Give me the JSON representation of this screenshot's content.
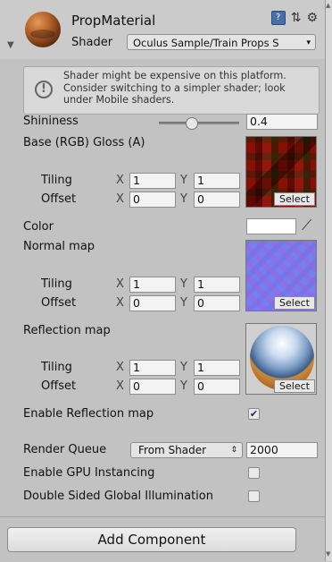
{
  "header": {
    "title": "PropMaterial",
    "shader_label": "Shader",
    "shader_value": "Oculus Sample/Train Props S",
    "icons": [
      "material-sphere-icon",
      "book-icon",
      "preset-icon",
      "gear-icon"
    ]
  },
  "warning": {
    "text": "Shader might be expensive on this platform. Consider switching to a simpler shader; look under Mobile shaders."
  },
  "shininess": {
    "label": "Shininess",
    "value": "0.4",
    "level": 0.4
  },
  "base": {
    "label": "Base (RGB) Gloss (A)",
    "tiling_label": "Tiling",
    "offset_label": "Offset",
    "tiling_x": "1",
    "tiling_y": "1",
    "offset_x": "0",
    "offset_y": "0",
    "select": "Select"
  },
  "color": {
    "label": "Color",
    "value": "#ffffff"
  },
  "normal": {
    "label": "Normal map",
    "tiling_label": "Tiling",
    "offset_label": "Offset",
    "tiling_x": "1",
    "tiling_y": "1",
    "offset_x": "0",
    "offset_y": "0",
    "select": "Select"
  },
  "reflection": {
    "label": "Reflection map",
    "tiling_label": "Tiling",
    "offset_label": "Offset",
    "tiling_x": "1",
    "tiling_y": "1",
    "offset_x": "0",
    "offset_y": "0",
    "select": "Select"
  },
  "axes": {
    "x": "X",
    "y": "Y"
  },
  "enable_reflection": {
    "label": "Enable Reflection map",
    "checked": true
  },
  "render_queue": {
    "label": "Render Queue",
    "dropdown": "From Shader",
    "value": "2000"
  },
  "gpu_instancing": {
    "label": "Enable GPU Instancing",
    "checked": false
  },
  "double_sided_gi": {
    "label": "Double Sided Global Illumination",
    "checked": false
  },
  "footer": {
    "add_component": "Add Component"
  }
}
